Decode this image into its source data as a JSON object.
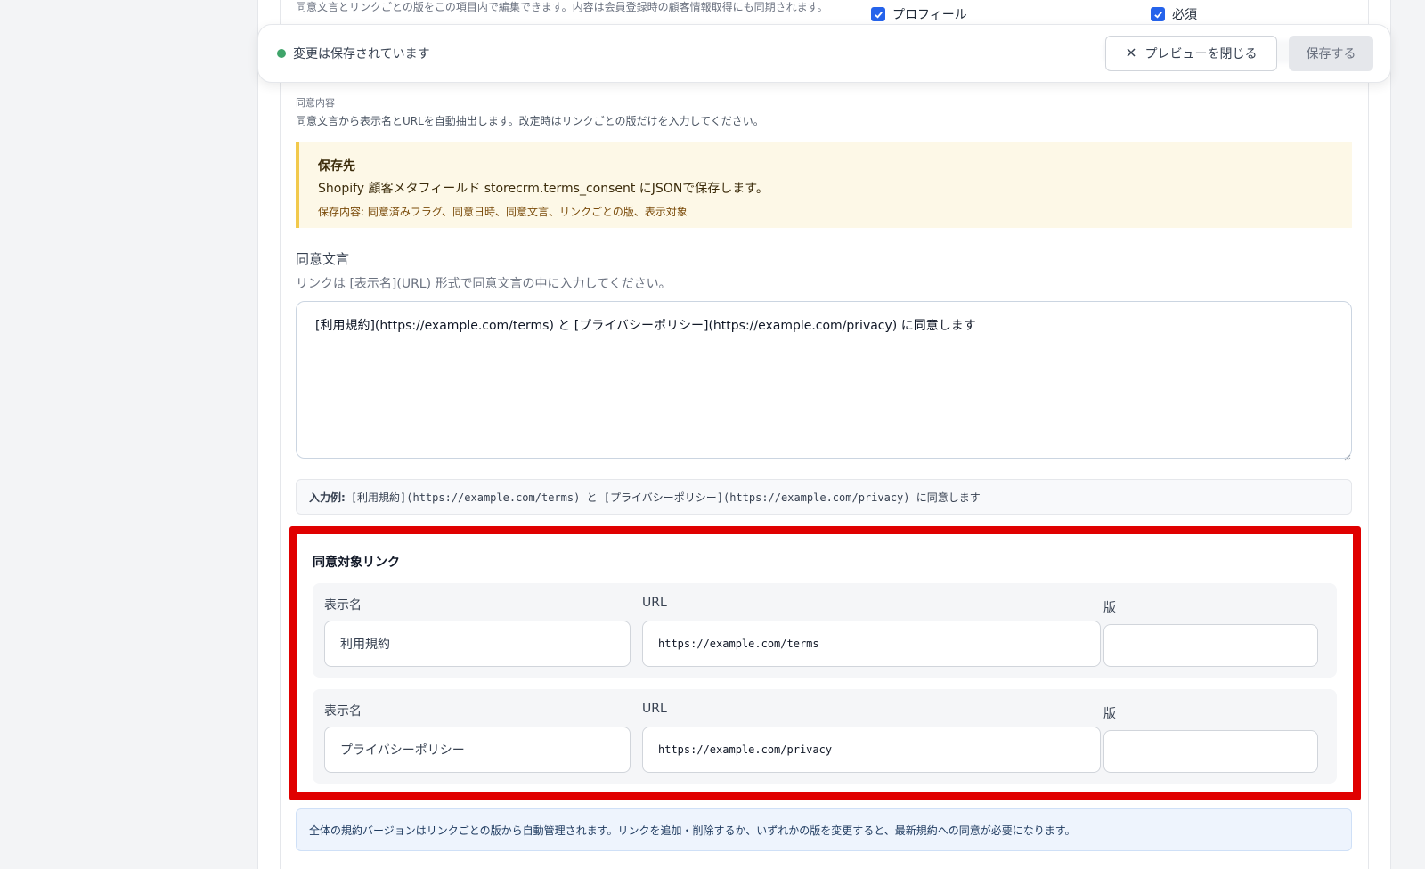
{
  "top": {
    "description": "同意文言とリンクごとの版をこの項目内で編集できます。内容は会員登録時の顧客情報取得にも同期されます。",
    "checkboxes": [
      {
        "label": "プロフィール",
        "checked": true
      },
      {
        "label": "必須",
        "checked": true
      }
    ]
  },
  "savebar": {
    "status": "変更は保存されています",
    "status_color": "#3fa46a",
    "close_preview_label": "プレビューを閉じる",
    "save_label": "保存する"
  },
  "consent": {
    "section_label": "同意内容",
    "section_desc": "同意文言から表示名とURLを自動抽出します。改定時はリンクごとの版だけを入力してください。",
    "notice": {
      "title": "保存先",
      "main": "Shopify 顧客メタフィールド storecrm.terms_consent にJSONで保存します。",
      "sub": "保存内容: 同意済みフラグ、同意日時、同意文言、リンクごとの版、表示対象"
    },
    "text_field": {
      "label": "同意文言",
      "help": "リンクは [表示名](URL) 形式で同意文言の中に入力してください。",
      "value": "[利用規約](https://example.com/terms) と [プライバシーポリシー](https://example.com/privacy) に同意します"
    },
    "example": {
      "prefix": "入力例:",
      "code": "[利用規約](https://example.com/terms) と [プライバシーポリシー](https://example.com/privacy) に同意します"
    },
    "links": {
      "title": "同意対象リンク",
      "highlight_color": "#e00000",
      "rows": [
        {
          "name_label": "表示名",
          "url_label": "URL",
          "version_label": "版",
          "name": "利用規約",
          "url": "https://example.com/terms",
          "version": ""
        },
        {
          "name_label": "表示名",
          "url_label": "URL",
          "version_label": "版",
          "name": "プライバシーポリシー",
          "url": "https://example.com/privacy",
          "version": ""
        }
      ]
    },
    "info": "全体の規約バージョンはリンクごとの版から自動管理されます。リンクを追加・削除するか、いずれかの版を変更すると、最新規約への同意が必要になります。"
  }
}
